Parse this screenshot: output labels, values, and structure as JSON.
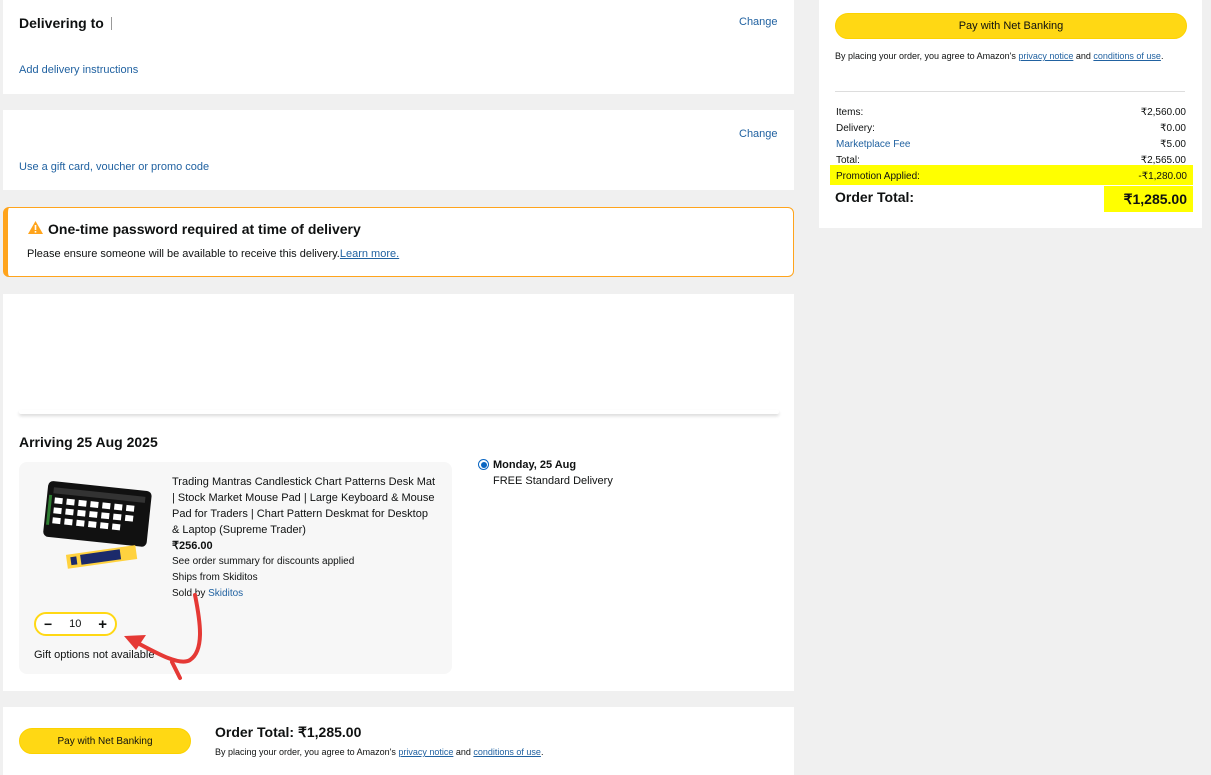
{
  "delivery": {
    "title": "Delivering to",
    "change": "Change",
    "instructions": "Add delivery instructions"
  },
  "payment": {
    "change": "Change",
    "gift_card": "Use a gift card, voucher or promo code"
  },
  "otp": {
    "title": "One-time password required at time of delivery",
    "text": "Please ensure someone will be available to receive this delivery.",
    "learn_more": "Learn more."
  },
  "shipment": {
    "arriving": "Arriving 25 Aug 2025",
    "product": {
      "title": "Trading Mantras Candlestick Chart Patterns Desk Mat | Stock Market Mouse Pad | Large Keyboard & Mouse Pad for Traders | Chart Pattern Deskmat for Desktop & Laptop (Supreme Trader)",
      "price": "₹256.00",
      "discount_note": "See order summary for discounts applied",
      "ships_from": "Ships from Skiditos",
      "sold_by_label": "Sold by ",
      "seller": "Skiditos",
      "quantity": "10",
      "minus": "−",
      "plus": "+",
      "gift_note": "Gift options not available"
    },
    "delivery_option": {
      "date": "Monday, 25 Aug",
      "type": "FREE Standard Delivery",
      "selected": true
    }
  },
  "bottom": {
    "pay_button": "Pay with Net Banking",
    "order_total": "Order Total: ₹1,285.00",
    "agree_prefix": "By placing your order, you agree to Amazon's ",
    "privacy": "privacy notice",
    "and": " and ",
    "conditions": "conditions of use",
    "period": "."
  },
  "summary": {
    "pay_button": "Pay with Net Banking",
    "agree_prefix": "By placing your order, you agree to Amazon's ",
    "privacy": "privacy notice",
    "and": " and ",
    "conditions": "conditions of use",
    "period": ".",
    "rows": {
      "items_label": "Items:",
      "items_value": "₹2,560.00",
      "delivery_label": "Delivery:",
      "delivery_value": "₹0.00",
      "fee_label": "Marketplace Fee",
      "fee_value": "₹5.00",
      "total_label": "Total:",
      "total_value": "₹2,565.00",
      "promo_label": "Promotion Applied:",
      "promo_value": "-₹1,280.00"
    },
    "order_total_label": "Order Total:",
    "order_total_value": "₹1,285.00"
  },
  "colors": {
    "highlight": "#ffff00",
    "button": "#ffd814",
    "link": "#2162a1",
    "alert": "#ffa41c",
    "arrow": "#e53935"
  }
}
